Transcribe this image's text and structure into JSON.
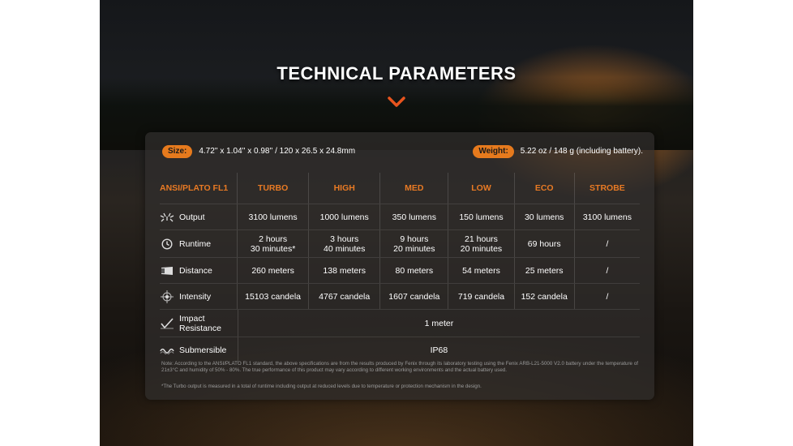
{
  "title": "TECHNICAL PARAMETERS",
  "size": {
    "label": "Size:",
    "value": "4.72'' x 1.04'' x 0.98'' / 120 x 26.5 x 24.8mm"
  },
  "weight": {
    "label": "Weight:",
    "value": "5.22 oz / 148 g (including battery)."
  },
  "table": {
    "corner": "ANSI/PLATO FL1",
    "modes": [
      "TURBO",
      "HIGH",
      "MED",
      "LOW",
      "ECO",
      "STROBE"
    ],
    "rows": {
      "output": {
        "label": "Output",
        "icon": "light-burst-icon",
        "values": [
          "3100 lumens",
          "1000 lumens",
          "350 lumens",
          "150 lumens",
          "30 lumens",
          "3100 lumens"
        ]
      },
      "runtime": {
        "label": "Runtime",
        "icon": "clock-icon",
        "values": [
          [
            "2 hours",
            "30 minutes*"
          ],
          [
            "3 hours",
            "40 minutes"
          ],
          [
            "9 hours",
            "20 minutes"
          ],
          [
            "21 hours",
            "20 minutes"
          ],
          [
            "69 hours"
          ],
          [
            "/"
          ]
        ]
      },
      "distance": {
        "label": "Distance",
        "icon": "beam-distance-icon",
        "values": [
          "260 meters",
          "138 meters",
          "80 meters",
          "54 meters",
          "25 meters",
          "/"
        ]
      },
      "intensity": {
        "label": "Intensity",
        "icon": "crosshair-star-icon",
        "values": [
          "15103 candela",
          "4767 candela",
          "1607 candela",
          "719 candela",
          "152 candela",
          "/"
        ]
      },
      "impact": {
        "label_line1": "Impact",
        "label_line2": "Resistance",
        "icon": "impact-check-icon",
        "value": "1 meter"
      },
      "submersible": {
        "label": "Submersible",
        "icon": "water-wave-icon",
        "value": "IP68"
      }
    }
  },
  "note": "Note: According to the ANSI/PLATO FL1 standard, the above specifications are from the results produced by Fenix through its laboratory testing using the Fenix ARB-L21-5000 V2.0 battery under the temperature of 21±3°C and humidity of 50% - 80%. The true performance of this product may vary according to different working environments and the actual battery used.",
  "footnote": "*The Turbo output is measured in a total of runtime including output at reduced levels due to temperature or protection mechanism in the design.",
  "colors": {
    "accent": "#e87a24",
    "badge": "#e67a1d",
    "text": "#ffffff",
    "note": "#9a9a9a"
  }
}
